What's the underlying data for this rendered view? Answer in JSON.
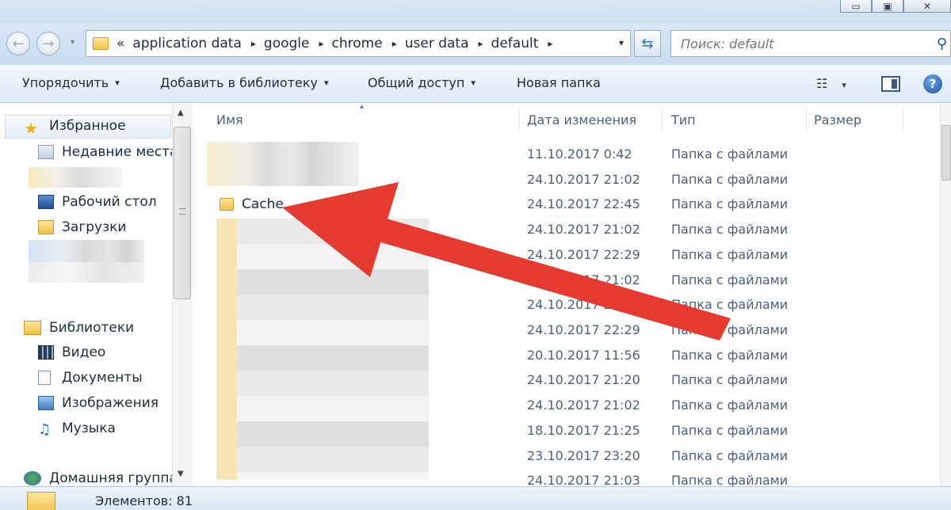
{
  "nav": {
    "back_glyph": "←",
    "forward_glyph": "→",
    "dropdown_glyph": "▾",
    "refresh_glyph": "⇆"
  },
  "address": {
    "prefix": "«",
    "segments": [
      "application data",
      "google",
      "chrome",
      "user data",
      "default"
    ],
    "separator": "▸",
    "dropdown": "▾"
  },
  "search": {
    "placeholder": "Поиск: default",
    "icon": "search-icon"
  },
  "toolbar": {
    "organize": "Упорядочить",
    "add_to_library": "Добавить в библиотеку",
    "share": "Общий доступ",
    "new_folder": "Новая папка",
    "caret": "▾",
    "view_glyph": "☷",
    "help": "?"
  },
  "sidebar": {
    "favorites": "Избранное",
    "recent": "Недавние места",
    "desktop": "Рабочий стол",
    "downloads": "Загрузки",
    "libraries": "Библиотеки",
    "video": "Видео",
    "documents": "Документы",
    "images": "Изображения",
    "music": "Музыка",
    "homegroup": "Домашняя группа"
  },
  "columns": {
    "name": "Имя",
    "date": "Дата изменения",
    "type": "Тип",
    "size": "Размер"
  },
  "rows": [
    {
      "name": "",
      "date": "11.10.2017 0:42",
      "type": "Папка с файлами"
    },
    {
      "name": "",
      "date": "24.10.2017 21:02",
      "type": "Папка с файлами"
    },
    {
      "name": "Cache",
      "date": "24.10.2017 22:45",
      "type": "Папка с файлами"
    },
    {
      "name": "",
      "date": "24.10.2017 21:02",
      "type": "Папка с файлами"
    },
    {
      "name": "",
      "date": "24.10.2017 22:29",
      "type": "Папка с файлами"
    },
    {
      "name": "",
      "date": "24.10.2017 21:02",
      "type": "Папка с файлами"
    },
    {
      "name": "",
      "date": "24.10.2017 21:02",
      "type": "Папка с файлами"
    },
    {
      "name": "",
      "date": "24.10.2017 22:29",
      "type": "Папка с файлами"
    },
    {
      "name": "",
      "date": "20.10.2017 11:56",
      "type": "Папка с файлами"
    },
    {
      "name": "",
      "date": "24.10.2017 21:20",
      "type": "Папка с файлами"
    },
    {
      "name": "",
      "date": "24.10.2017 21:02",
      "type": "Папка с файлами"
    },
    {
      "name": "",
      "date": "18.10.2017 21:25",
      "type": "Папка с файлами"
    },
    {
      "name": "",
      "date": "23.10.2017 23:20",
      "type": "Папка с файлами"
    },
    {
      "name": "",
      "date": "24.10.2017 21:03",
      "type": "Папка с файлами"
    }
  ],
  "status": {
    "items": "Элементов: 81"
  },
  "colors": {
    "arrow": "#e53a2f",
    "accent": "#1d4f9c"
  }
}
